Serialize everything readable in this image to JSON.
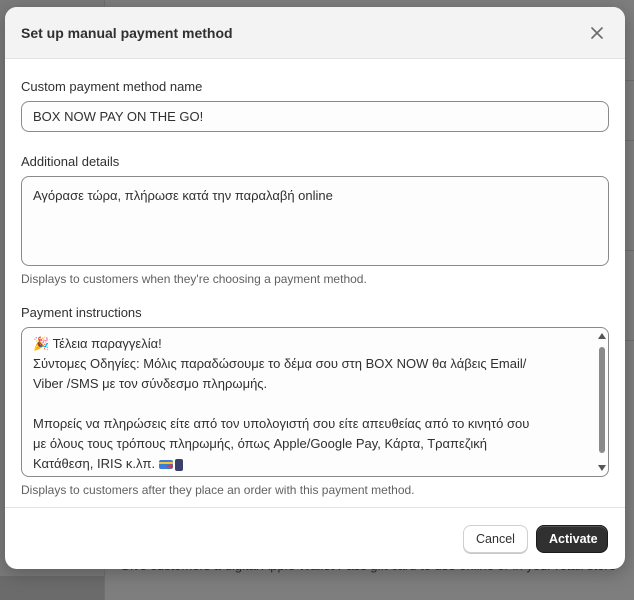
{
  "modal": {
    "title": "Set up manual payment method",
    "close_icon": "close-icon"
  },
  "name_field": {
    "label": "Custom payment method name",
    "value": "BOX NOW PAY ON THE GO!"
  },
  "details_field": {
    "label": "Additional details",
    "value": "Αγόρασε τώρα, πλήρωσε κατά την παραλαβή online",
    "help": "Displays to customers when they're choosing a payment method."
  },
  "instructions_field": {
    "label": "Payment instructions",
    "lines": [
      "🎉 Τέλεια παραγγελία!",
      "Σύντομες Οδηγίες: Μόλις παραδώσουμε το δέμα σου στη BOX NOW θα λάβεις Email/",
      "Viber /SMS με τον σύνδεσμο πληρωμής.",
      "",
      "Μπορείς να πληρώσεις είτε από τον υπολογιστή σου είτε απευθείας από το κινητό σου",
      "με όλους τους τρόπους πληρωμής, όπως Apple/Google Pay, Κάρτα, Τραπεζική",
      "Κατάθεση, IRIS κ.λπ."
    ],
    "help": "Displays to customers after they place an order with this payment method."
  },
  "footer": {
    "cancel_label": "Cancel",
    "activate_label": "Activate"
  },
  "background": {
    "text": "Give customers a digital Apple Wallet Pass gift card to use online or in your retail store"
  }
}
